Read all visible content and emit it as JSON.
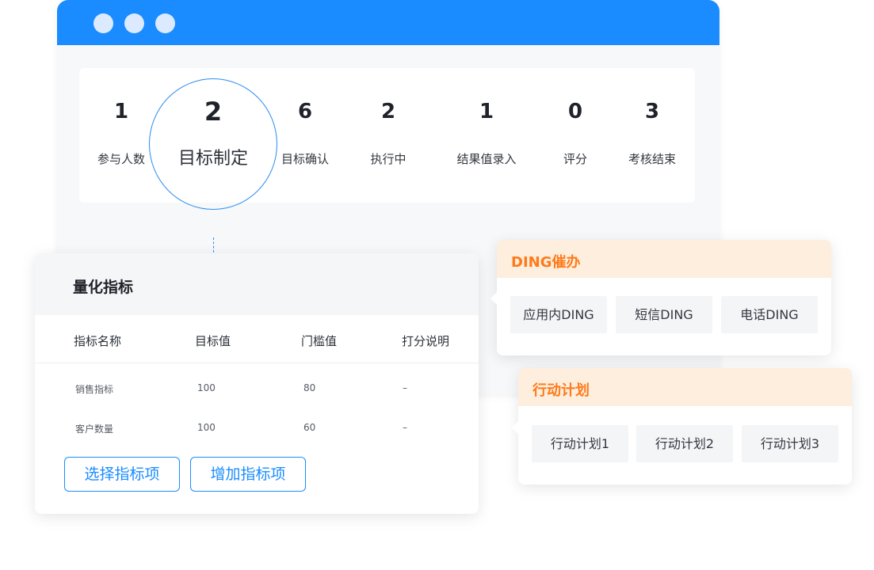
{
  "stats": [
    {
      "value": "1",
      "label": "参与人数"
    },
    {
      "value": "2",
      "label": "目标制定"
    },
    {
      "value": "6",
      "label": "目标确认"
    },
    {
      "value": "2",
      "label": "执行中"
    },
    {
      "value": "1",
      "label": "结果值录入"
    },
    {
      "value": "0",
      "label": "评分"
    },
    {
      "value": "3",
      "label": "考核结束"
    }
  ],
  "metrics": {
    "title": "量化指标",
    "columns": [
      "指标名称",
      "目标值",
      "门槛值",
      "打分说明"
    ],
    "rows": [
      [
        "销售指标",
        "100",
        "80",
        "–"
      ],
      [
        "客户数量",
        "100",
        "60",
        "–"
      ]
    ],
    "select_button": "选择指标项",
    "add_button": "增加指标项"
  },
  "ding": {
    "title": "DING催办",
    "options": [
      "应用内DING",
      "短信DING",
      "电话DING"
    ]
  },
  "plan": {
    "title": "行动计划",
    "options": [
      "行动计划1",
      "行动计划2",
      "行动计划3"
    ]
  },
  "colors": {
    "primary": "#1a8cff",
    "accent_orange": "#ff7a1a",
    "popover_header": "#fdeede"
  }
}
